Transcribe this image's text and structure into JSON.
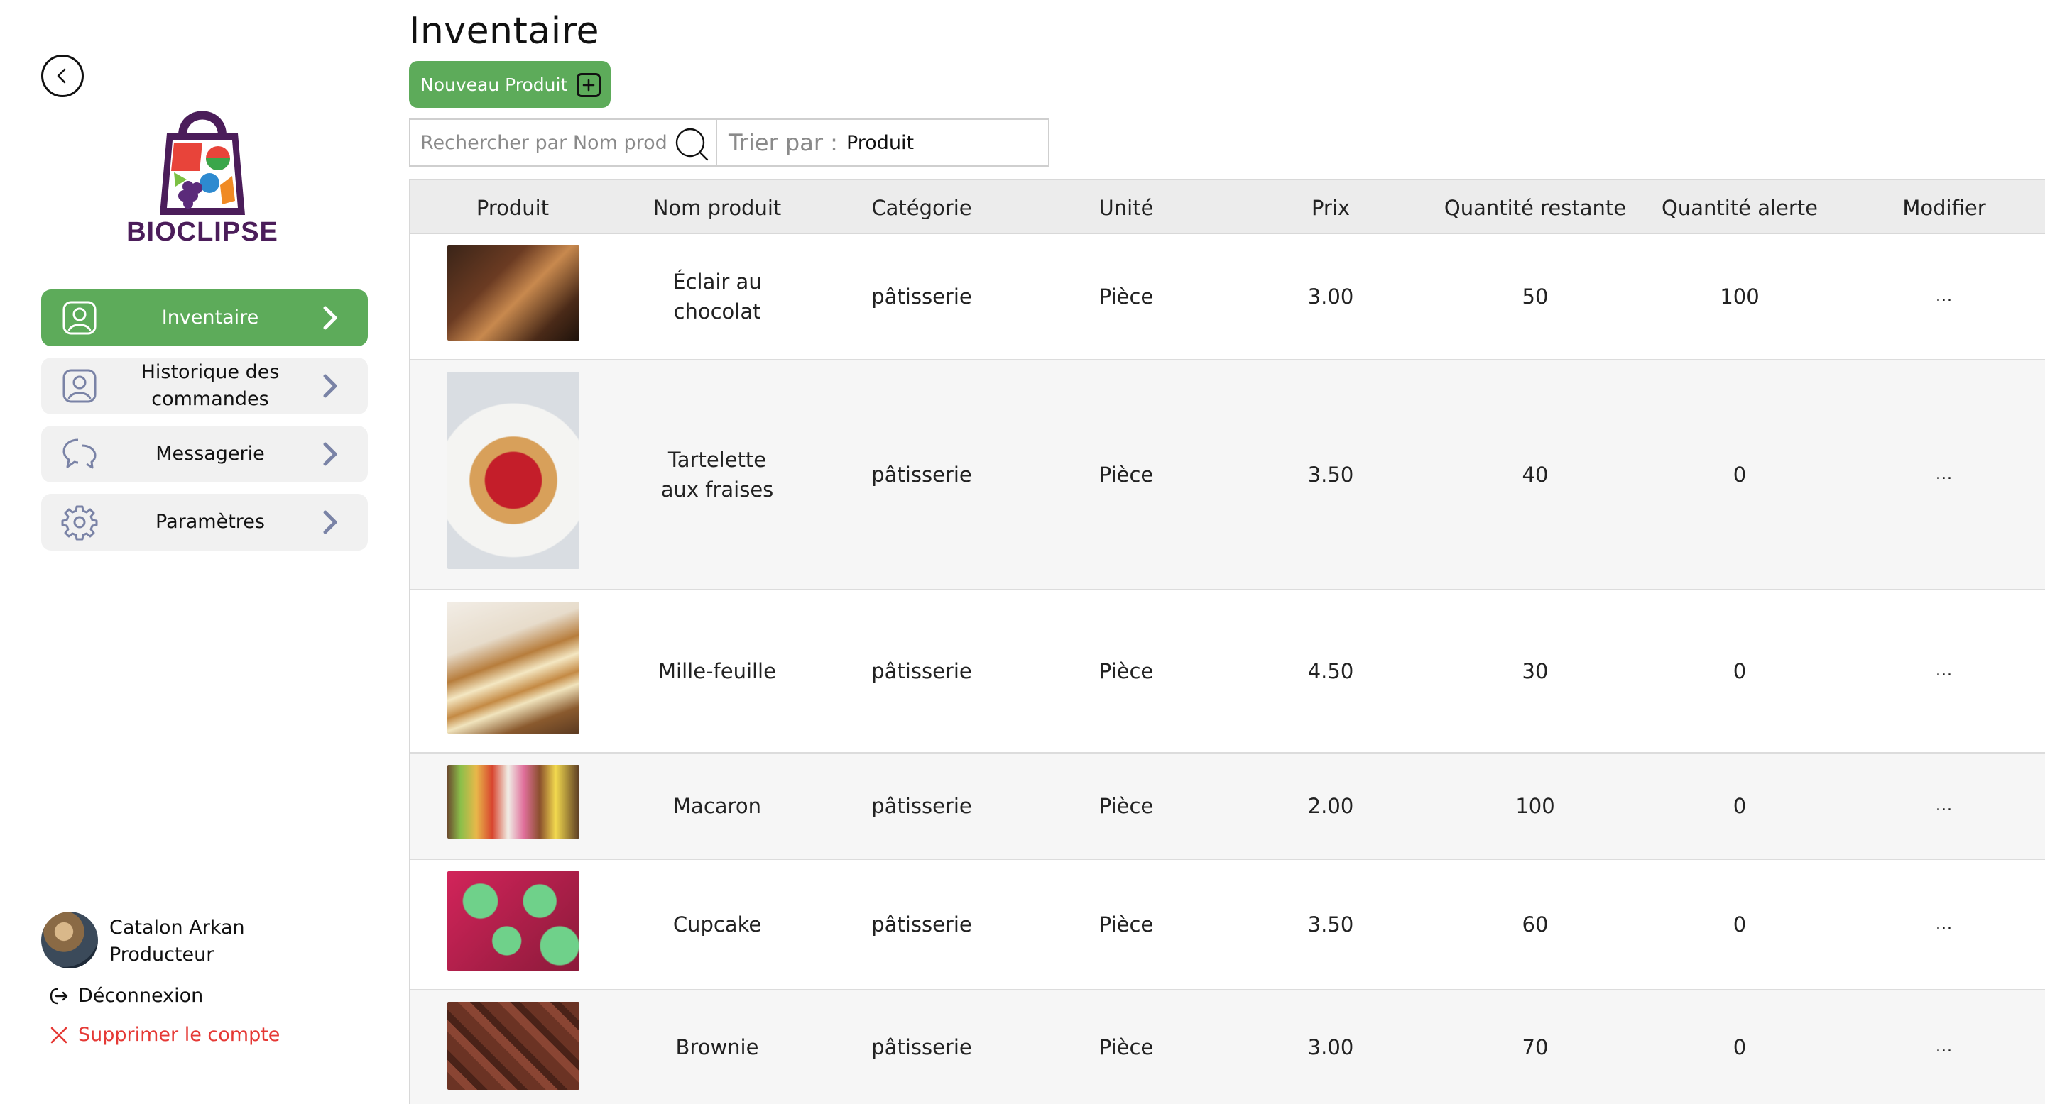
{
  "sidebar": {
    "logo_text": "BIOCLIPSE",
    "nav": [
      {
        "label": "Inventaire",
        "icon": "user-square-icon",
        "active": true
      },
      {
        "label": "Historique des commandes",
        "icon": "user-square-icon",
        "active": false
      },
      {
        "label": "Messagerie",
        "icon": "chat-bubbles-icon",
        "active": false
      },
      {
        "label": "Paramètres",
        "icon": "gear-icon",
        "active": false
      }
    ],
    "user": {
      "name": "Catalon Arkan",
      "role": "Producteur",
      "logout": "Déconnexion",
      "delete_account": "Supprimer le compte"
    }
  },
  "main": {
    "title": "Inventaire",
    "new_product": "Nouveau Produit",
    "search_placeholder": "Rechercher par Nom produit",
    "sort_label": "Trier par :",
    "sort_value": "Produit",
    "columns": [
      "Produit",
      "Nom produit",
      "Catégorie",
      "Unité",
      "Prix",
      "Quantité restante",
      "Quantité alerte",
      "Modifier"
    ],
    "rows": [
      {
        "name": "Éclair au chocolat",
        "category": "pâtisserie",
        "unit": "Pièce",
        "price": "3.00",
        "qty": "50",
        "alert": "100",
        "edit": "..."
      },
      {
        "name": "Tartelette aux fraises",
        "category": "pâtisserie",
        "unit": "Pièce",
        "price": "3.50",
        "qty": "40",
        "alert": "0",
        "edit": "..."
      },
      {
        "name": "Mille-feuille",
        "category": "pâtisserie",
        "unit": "Pièce",
        "price": "4.50",
        "qty": "30",
        "alert": "0",
        "edit": "..."
      },
      {
        "name": "Macaron",
        "category": "pâtisserie",
        "unit": "Pièce",
        "price": "2.00",
        "qty": "100",
        "alert": "0",
        "edit": "..."
      },
      {
        "name": "Cupcake",
        "category": "pâtisserie",
        "unit": "Pièce",
        "price": "3.50",
        "qty": "60",
        "alert": "0",
        "edit": "..."
      },
      {
        "name": "Brownie",
        "category": "pâtisserie",
        "unit": "Pièce",
        "price": "3.00",
        "qty": "70",
        "alert": "0",
        "edit": "..."
      }
    ]
  },
  "colors": {
    "accent_green": "#5dab5a",
    "logo_purple": "#4b1d5a",
    "danger_red": "#e53935"
  }
}
